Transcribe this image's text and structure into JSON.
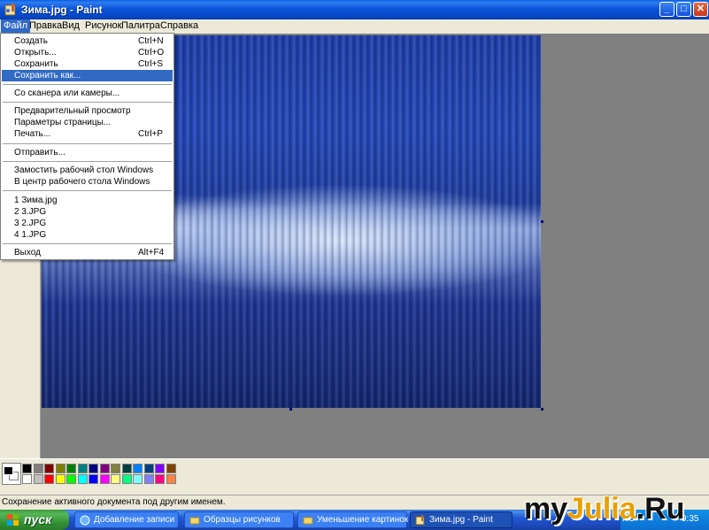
{
  "window": {
    "title": "Зима.jpg - Paint",
    "controls": {
      "minimize": "_",
      "maximize": "□",
      "close": "✕"
    }
  },
  "menubar": {
    "items": [
      {
        "label": "Файл",
        "active": true
      },
      {
        "label": "Правка"
      },
      {
        "label": "Вид"
      },
      {
        "label": "Рисунок"
      },
      {
        "label": "Палитра"
      },
      {
        "label": "Справка"
      }
    ]
  },
  "file_menu": {
    "items": [
      {
        "label": "Создать",
        "shortcut": "Ctrl+N"
      },
      {
        "label": "Открыть...",
        "shortcut": "Ctrl+O"
      },
      {
        "label": "Сохранить",
        "shortcut": "Ctrl+S"
      },
      {
        "label": "Сохранить как...",
        "highlighted": true
      },
      {
        "label": "Со сканера или камеры..."
      },
      {
        "label": "Предварительный просмотр"
      },
      {
        "label": "Параметры страницы..."
      },
      {
        "label": "Печать...",
        "shortcut": "Ctrl+P"
      },
      {
        "label": "Отправить..."
      },
      {
        "label": "Замостить рабочий стол Windows"
      },
      {
        "label": "В центр рабочего стола Windows"
      },
      {
        "label": "1 Зима.jpg"
      },
      {
        "label": "2 3.JPG"
      },
      {
        "label": "3 2.JPG"
      },
      {
        "label": "4 1.JPG"
      },
      {
        "label": "Выход",
        "shortcut": "Alt+F4"
      }
    ]
  },
  "palette": {
    "foreground": "#000000",
    "background": "#ffffff",
    "colors_top": [
      "#000000",
      "#808080",
      "#800000",
      "#808000",
      "#008000",
      "#008080",
      "#000080",
      "#800080",
      "#808040",
      "#004040",
      "#0080ff",
      "#004080",
      "#8000ff",
      "#804000"
    ],
    "colors_bottom": [
      "#ffffff",
      "#c0c0c0",
      "#ff0000",
      "#ffff00",
      "#00ff00",
      "#00ffff",
      "#0000ff",
      "#ff00ff",
      "#ffff80",
      "#00ff80",
      "#80ffff",
      "#8080ff",
      "#ff0080",
      "#ff8040"
    ]
  },
  "statusbar": {
    "text": "Сохранение активного документа под другим именем."
  },
  "taskbar": {
    "start_label": "пуск",
    "tasks": [
      {
        "label": "Добавление записи ..."
      },
      {
        "label": "Образцы рисунков"
      },
      {
        "label": "Уменьшение картинок"
      },
      {
        "label": "Зима.jpg - Paint",
        "active": true
      }
    ],
    "tray": {
      "language": "RU",
      "clock": "9:35"
    }
  },
  "watermark": {
    "prefix": "my",
    "accent": "Julia",
    "suffix": ".Ru"
  }
}
